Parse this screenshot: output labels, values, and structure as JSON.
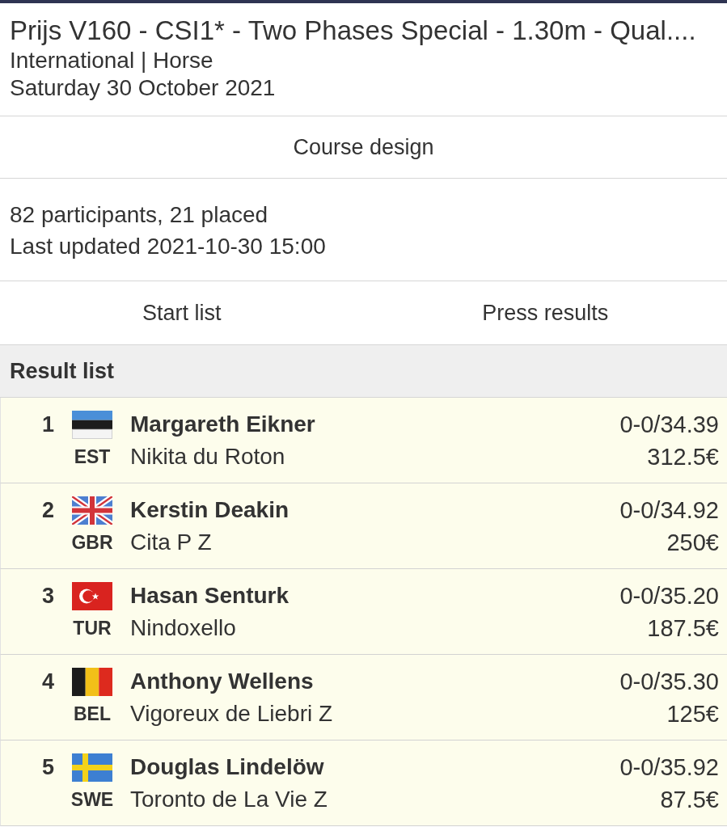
{
  "header": {
    "title": "Prijs V160 - CSI1* - Two Phases Special - 1.30m - Qual....",
    "subtitle": "International | Horse",
    "date": "Saturday 30 October 2021"
  },
  "course_design": {
    "label": "Course design"
  },
  "info": {
    "participants": "82 participants, 21 placed",
    "updated": "Last updated 2021-10-30 15:00"
  },
  "links": [
    "Start list",
    "Press results"
  ],
  "result_list": {
    "title": "Result list",
    "rows": [
      {
        "rank": "1",
        "kind": "estonia",
        "country": "EST",
        "rider": "Margareth Eikner",
        "horse": "Nikita du Roton",
        "result": "0-0/34.39",
        "prize": "312.5€"
      },
      {
        "rank": "2",
        "kind": "britain",
        "country": "GBR",
        "rider": "Kerstin Deakin",
        "horse": "Cita P Z",
        "result": "0-0/34.92",
        "prize": "250€"
      },
      {
        "rank": "3",
        "kind": "turkey",
        "country": "TUR",
        "rider": "Hasan Senturk",
        "horse": "Nindoxello",
        "result": "0-0/35.20",
        "prize": "187.5€"
      },
      {
        "rank": "4",
        "kind": "belgium",
        "country": "BEL",
        "rider": "Anthony Wellens",
        "horse": "Vigoreux de Liebri Z",
        "result": "0-0/35.30",
        "prize": "125€"
      },
      {
        "rank": "5",
        "kind": "sweden",
        "country": "SWE",
        "rider": "Douglas Lindelöw",
        "horse": "Toronto de La Vie Z",
        "result": "0-0/35.92",
        "prize": "87.5€"
      }
    ]
  }
}
